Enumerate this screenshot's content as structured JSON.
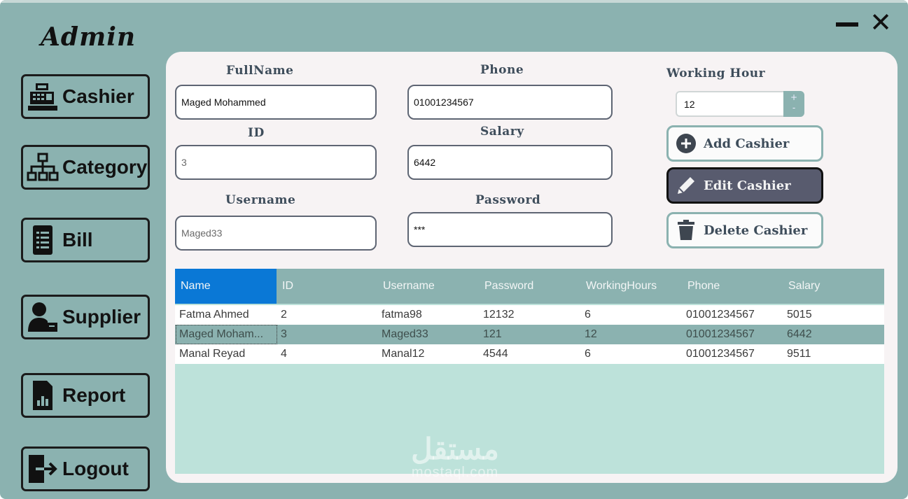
{
  "app": {
    "title": "Admin"
  },
  "window_controls": {
    "close_glyph": "✕"
  },
  "sidebar": {
    "items": [
      {
        "label": "Cashier",
        "icon": "cash-register-icon"
      },
      {
        "label": "Category",
        "icon": "sitemap-icon"
      },
      {
        "label": "Bill",
        "icon": "receipt-icon"
      },
      {
        "label": "Supplier",
        "icon": "user-tie-icon"
      },
      {
        "label": "Report",
        "icon": "report-chart-icon"
      },
      {
        "label": "Logout",
        "icon": "logout-icon"
      }
    ]
  },
  "form": {
    "fullname": {
      "label": "FullName",
      "value": "Maged Mohammed"
    },
    "phone": {
      "label": "Phone",
      "value": "01001234567"
    },
    "id": {
      "label": "ID",
      "value": "3"
    },
    "salary": {
      "label": "Salary",
      "value": "6442"
    },
    "username": {
      "label": "Username",
      "value": "Maged33"
    },
    "password": {
      "label": "Password",
      "value": "***"
    },
    "working_hour": {
      "label": "Working Hour",
      "value": "12",
      "plus": "+",
      "minus": "-"
    }
  },
  "actions": {
    "add": {
      "label": "Add Cashier",
      "icon": "plus-circle-icon"
    },
    "edit": {
      "label": "Edit Cashier",
      "icon": "pencil-icon"
    },
    "delete": {
      "label": "Delete Cashier",
      "icon": "trash-icon"
    }
  },
  "table": {
    "columns": [
      "Name",
      "ID",
      "Username",
      "Password",
      "WorkingHours",
      "Phone",
      "Salary"
    ],
    "rows": [
      [
        "Fatma Ahmed",
        "2",
        "fatma98",
        "12132",
        "6",
        "01001234567",
        "5015"
      ],
      [
        "Maged Moham...",
        "3",
        "Maged33",
        "121",
        "12",
        "01001234567",
        "6442"
      ],
      [
        "Manal Reyad",
        "4",
        "Manal12",
        "4544",
        "6",
        "01001234567",
        "9511"
      ]
    ],
    "selected_row": 1
  },
  "watermark": {
    "arabic": "مستقل",
    "latin": "mostaql.com"
  },
  "colors": {
    "background": "#8bb2b0",
    "panel": "#f7f3f4",
    "header_active": "#0a78d6",
    "grid_fill": "#bde2da",
    "edit_button": "#585b6e"
  }
}
